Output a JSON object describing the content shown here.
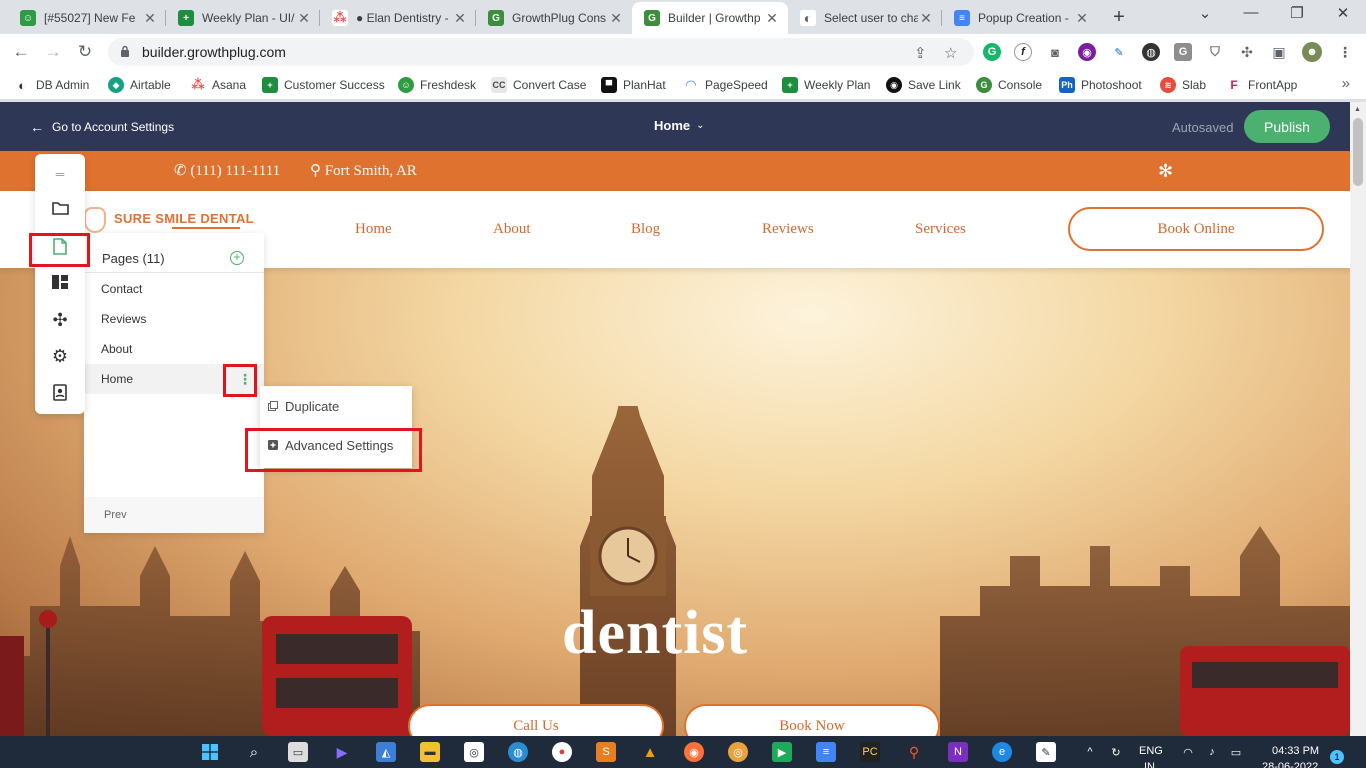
{
  "browser": {
    "tabs": [
      {
        "title": "[#55027] New Fe",
        "color": "#2f9b43",
        "glyph": "☺"
      },
      {
        "title": "Weekly Plan - UI/",
        "color": "#1e8e3e",
        "glyph": "+"
      },
      {
        "title": "● Elan Dentistry -",
        "color": "#e8554e",
        "glyph": "⁂"
      },
      {
        "title": "GrowthPlug Cons",
        "color": "#3c8d3c",
        "glyph": "G"
      },
      {
        "title": "Builder | Growthp",
        "color": "#3c8d3c",
        "glyph": "G"
      },
      {
        "title": "Select user to cha",
        "color": "#5f6368",
        "glyph": "◐"
      },
      {
        "title": "Popup Creation -",
        "color": "#4285f4",
        "glyph": "≡"
      }
    ],
    "new_tab": "+",
    "url": "builder.growthplug.com",
    "bookmarks": [
      {
        "label": "DB Admin",
        "color": "#333",
        "glyph": "◐"
      },
      {
        "label": "Airtable",
        "color": "#16a085",
        "glyph": "◆"
      },
      {
        "label": "Asana",
        "color": "#e8554e",
        "glyph": "⁂"
      },
      {
        "label": "Customer Success",
        "color": "#1e8e3e",
        "glyph": "+"
      },
      {
        "label": "Freshdesk",
        "color": "#2f9b43",
        "glyph": "☺"
      },
      {
        "label": "Convert Case",
        "color": "#555",
        "glyph": "CC"
      },
      {
        "label": "PlanHat",
        "color": "#111",
        "glyph": "▀"
      },
      {
        "label": "PageSpeed",
        "color": "#4285f4",
        "glyph": "◠"
      },
      {
        "label": "Weekly Plan",
        "color": "#1e8e3e",
        "glyph": "+"
      },
      {
        "label": "Save Link",
        "color": "#111",
        "glyph": "◉"
      },
      {
        "label": "Console",
        "color": "#3c8d3c",
        "glyph": "G"
      },
      {
        "label": "Photoshoot",
        "color": "#1565c0",
        "glyph": "Ph"
      },
      {
        "label": "Slab",
        "color": "#e74c3c",
        "glyph": "≋"
      },
      {
        "label": "FrontApp",
        "color": "#d81b60",
        "glyph": "F"
      }
    ],
    "bookmarks_more": "»"
  },
  "builder": {
    "back_label": "Go to Account Settings",
    "current_page": "Home",
    "autosave_status": "Autosaved",
    "publish_label": "Publish"
  },
  "site": {
    "phone": "(111) 111-1111",
    "location": "Fort Smith, AR",
    "logo_text": "SURE SMILE DENTAL",
    "nav": [
      "Home",
      "About",
      "Blog",
      "Reviews",
      "Services"
    ],
    "book_online": "Book Online",
    "hero_title": "dentist",
    "call_us": "Call Us",
    "book_now": "Book Now"
  },
  "pages_panel": {
    "title": "Pages (11)",
    "pages": [
      "Contact",
      "Reviews",
      "About",
      "Home"
    ],
    "prev_label": "Prev"
  },
  "context_menu": {
    "duplicate": "Duplicate",
    "advanced": "Advanced Settings"
  },
  "taskbar": {
    "language_top": "ENG",
    "language_bottom": "IN",
    "time": "04:33 PM",
    "date": "28-06-2022",
    "notifications": "1"
  },
  "colors": {
    "builder_header": "#2e3856",
    "publish": "#4cb070",
    "brand_orange": "#e0722f",
    "highlight": "#e3141d"
  }
}
